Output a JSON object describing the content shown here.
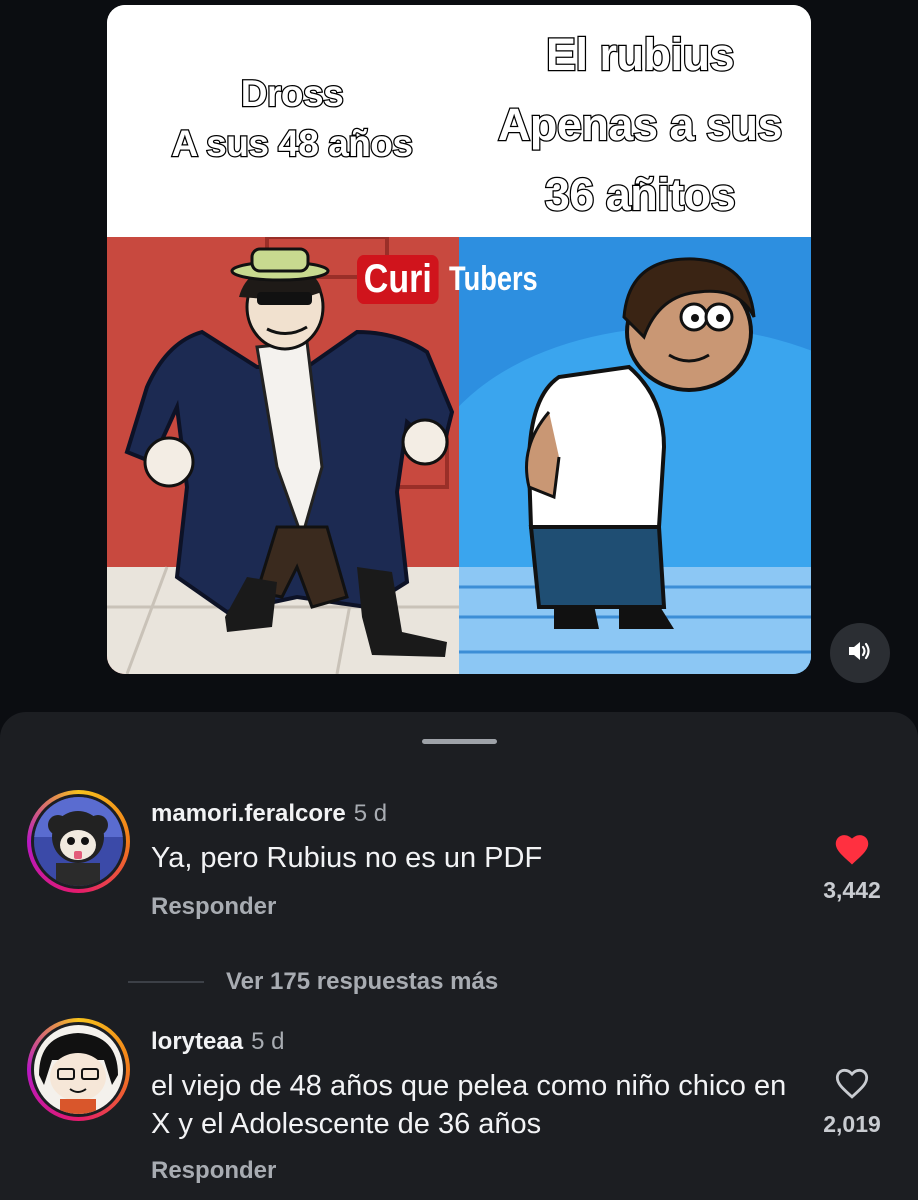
{
  "post": {
    "caption_left_line1": "Dross",
    "caption_left_line2": "A sus 48 años",
    "caption_right_line1": "El rubius",
    "caption_right_line2": "Apenas a sus",
    "caption_right_line3": "36 añitos",
    "watermark_left": "Curi",
    "watermark_right": "Tubers",
    "mute_icon": "speaker-icon"
  },
  "comments": [
    {
      "username": "mamori.feralcore",
      "time": "5 d",
      "text": "Ya, pero Rubius no es un PDF",
      "reply_label": "Responder",
      "likes": "3,442",
      "liked": true,
      "like_color": "#ff3040",
      "ring_colors": [
        "#f7c21c",
        "#e41b6c",
        "#b718c4"
      ]
    },
    {
      "username": "loryteaa",
      "time": "5 d",
      "text": "el viejo de 48 años que pelea como niño chico en X y el Adolescente de 36 años",
      "reply_label": "Responder",
      "likes": "2,019",
      "liked": false
    }
  ],
  "view_more_replies": "Ver 175 respuestas más"
}
